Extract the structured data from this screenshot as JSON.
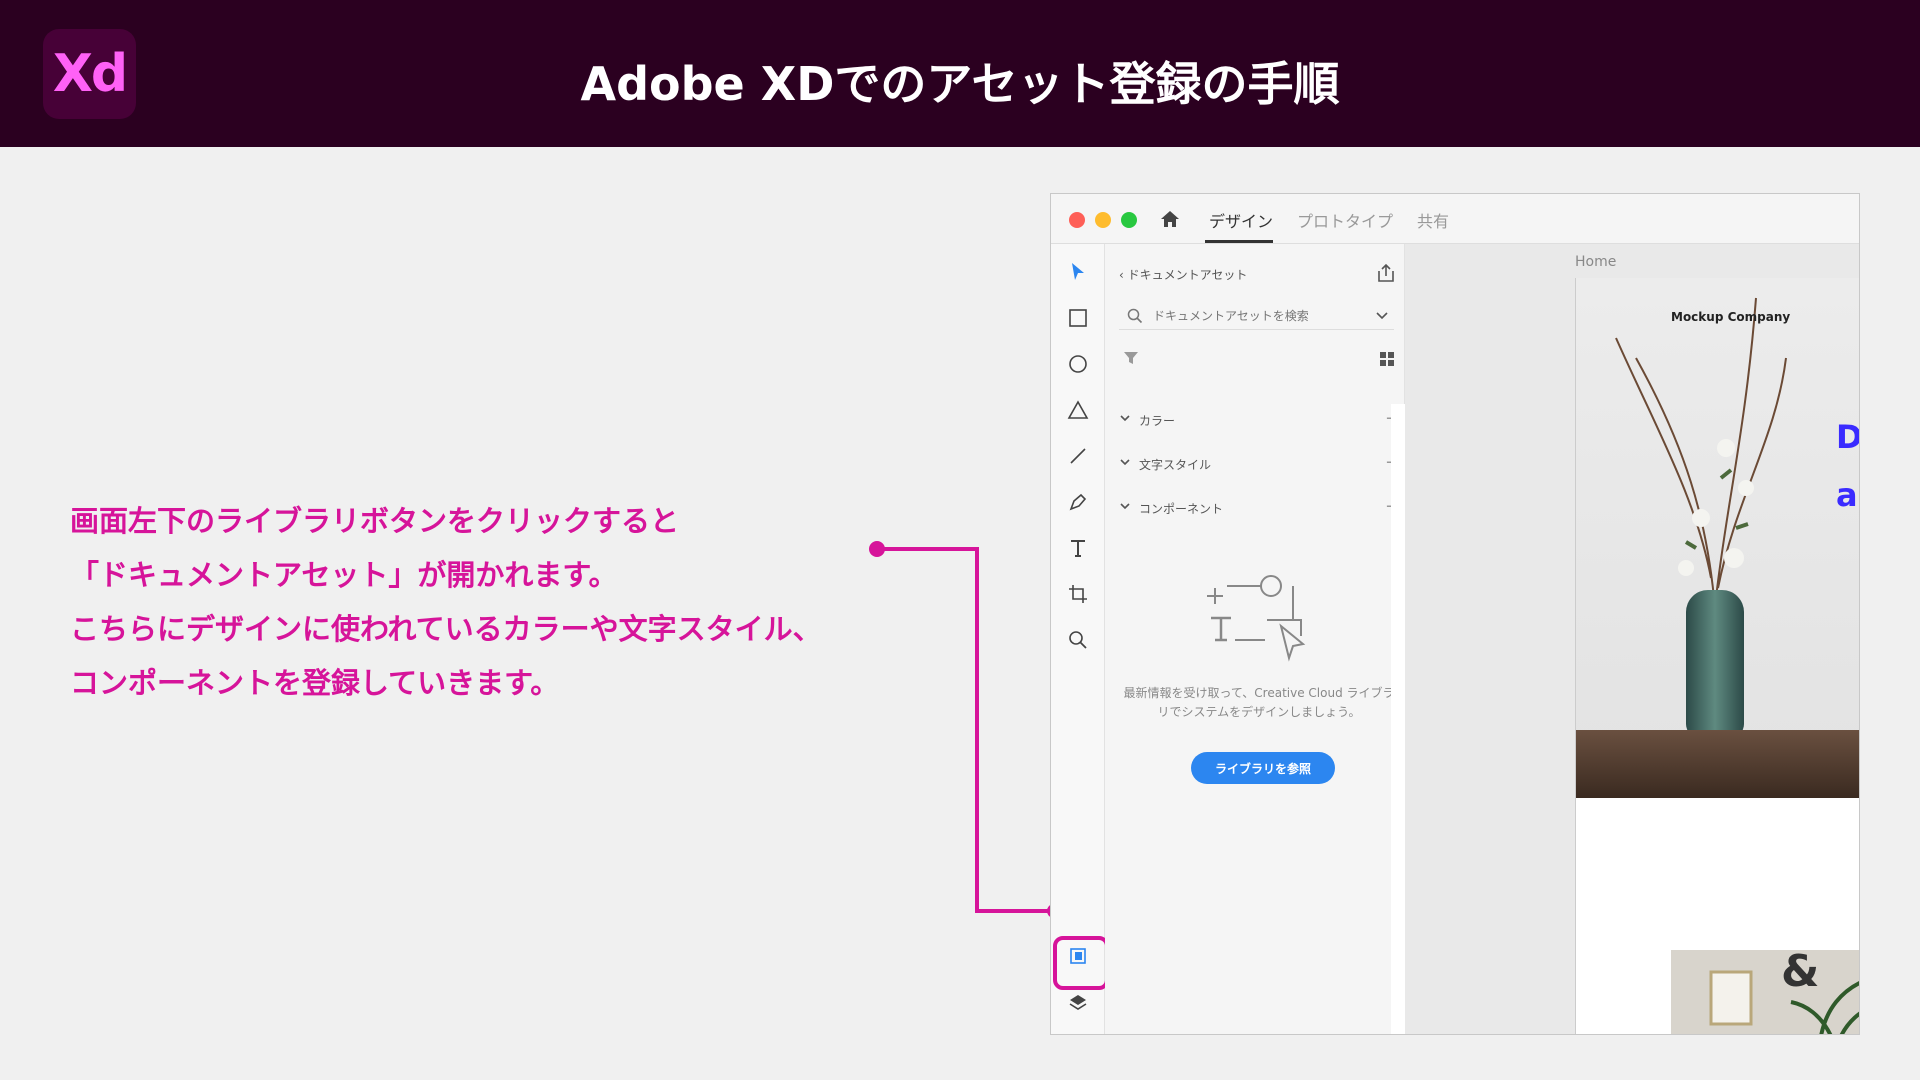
{
  "banner": {
    "logo_text": "Xd",
    "title": "Adobe XDでのアセット登録の手順"
  },
  "explanation": {
    "lines": [
      "画面左下のライブラリボタンをクリックすると",
      "「ドキュメントアセット」が開かれます。",
      "こちらにデザインに使われているカラーや文字スタイル、",
      "コンポーネントを登録していきます。"
    ]
  },
  "colors": {
    "banner_bg": "#2b0020",
    "accent": "#d6149a",
    "xd_pink": "#ff61f6",
    "button_blue": "#2c86f0"
  },
  "app": {
    "tabs": {
      "design": "デザイン",
      "prototype": "プロトタイプ",
      "share": "共有"
    },
    "panel": {
      "header": "ドキュメントアセット",
      "search_placeholder": "ドキュメントアセットを検索",
      "sections": [
        {
          "label": "カラー"
        },
        {
          "label": "文字スタイル"
        },
        {
          "label": "コンポーネント"
        }
      ],
      "empty_text_line1": "最新情報を受け取って、Creative Cloud ライブラ",
      "empty_text_line2": "リでシステムをデザインしましょう。",
      "browse_button": "ライブラリを参照"
    },
    "canvas": {
      "artboard_label": "Home",
      "company_name": "Mockup Company",
      "blue_letter_1": "D",
      "blue_letter_2": "a",
      "ampersand": "&"
    },
    "tools": [
      "select-icon",
      "rectangle-icon",
      "ellipse-icon",
      "polygon-icon",
      "line-icon",
      "pen-icon",
      "text-icon",
      "artboard-icon",
      "zoom-icon",
      "libraries-icon",
      "layers-icon",
      "plugins-icon"
    ]
  }
}
